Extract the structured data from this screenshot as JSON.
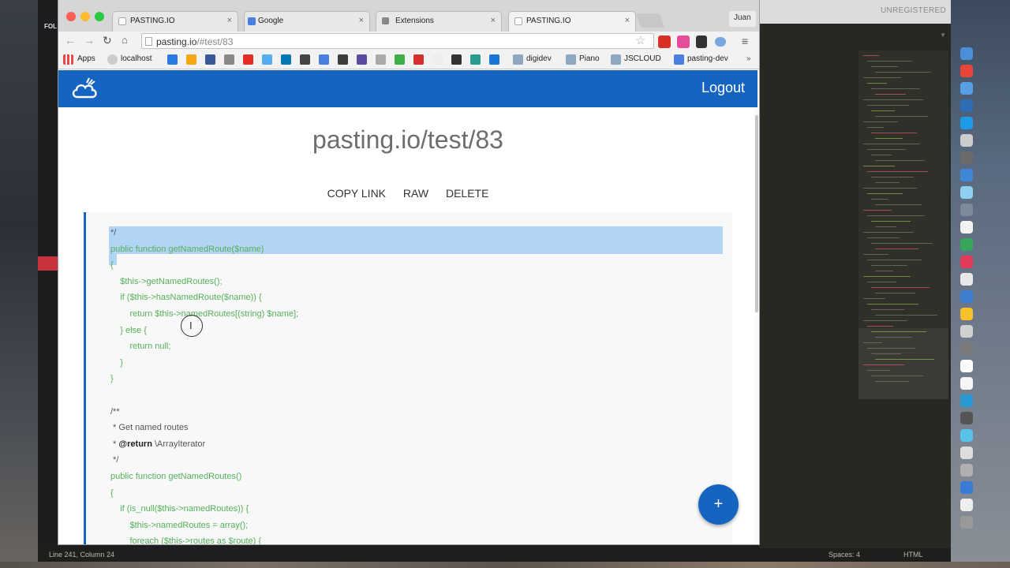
{
  "desktop": {
    "left_label": "FOL",
    "editor_unregistered": "UNREGISTERED",
    "editor_status": {
      "position": "Line 241, Column 24",
      "spaces": "Spaces: 4",
      "syntax": "HTML"
    }
  },
  "browser": {
    "tabs": [
      {
        "title": "PASTING.IO",
        "active": false
      },
      {
        "title": "Google",
        "active": false
      },
      {
        "title": "Extensions",
        "active": false
      },
      {
        "title": "PASTING.IO",
        "active": true
      }
    ],
    "user": "Juan",
    "url_host": "pasting.io",
    "url_path": "/#test/83",
    "bookmarks": [
      "Apps",
      "localhost",
      "digidev",
      "Piano",
      "JSCLOUD",
      "pasting-dev"
    ],
    "bookmark_more": "»"
  },
  "app": {
    "logout_label": "Logout",
    "title": "pasting.io/test/83",
    "actions": {
      "copy": "COPY LINK",
      "raw": "RAW",
      "delete": "DELETE"
    },
    "fab_label": "+",
    "code_lines": [
      {
        "text": "*/",
        "cls": "c"
      },
      {
        "text": "public function getNamedRoute($name)",
        "cls": ""
      },
      {
        "text": "{",
        "cls": ""
      },
      {
        "text": "    $this->getNamedRoutes();",
        "cls": ""
      },
      {
        "text": "    if ($this->hasNamedRoute($name)) {",
        "cls": ""
      },
      {
        "text": "        return $this->namedRoutes[(string) $name];",
        "cls": ""
      },
      {
        "text": "    } else {",
        "cls": ""
      },
      {
        "text": "        return null;",
        "cls": ""
      },
      {
        "text": "    }",
        "cls": ""
      },
      {
        "text": "}",
        "cls": ""
      },
      {
        "text": "",
        "cls": ""
      },
      {
        "text": "/**",
        "cls": "c"
      },
      {
        "text": " * Get named routes",
        "cls": "c"
      },
      {
        "text": " * @return \\ArrayIterator",
        "cls": "c"
      },
      {
        "text": " */",
        "cls": "c"
      },
      {
        "text": "public function getNamedRoutes()",
        "cls": ""
      },
      {
        "text": "{",
        "cls": ""
      },
      {
        "text": "    if (is_null($this->namedRoutes)) {",
        "cls": ""
      },
      {
        "text": "        $this->namedRoutes = array();",
        "cls": ""
      },
      {
        "text": "        foreach ($this->routes as $route) {",
        "cls": ""
      }
    ]
  }
}
